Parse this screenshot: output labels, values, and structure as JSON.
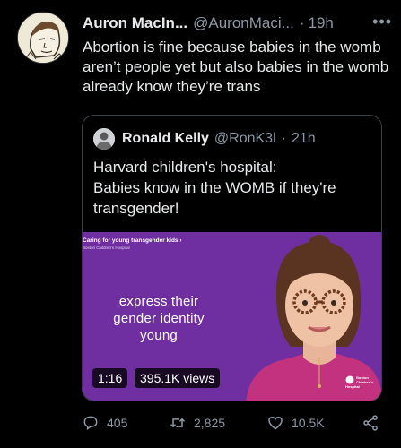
{
  "tweet": {
    "author_name": "Auron MacIn...",
    "author_handle": "@AuronMaci...",
    "separator": "·",
    "time": "19h",
    "more_label": "•••",
    "text": "Abortion is fine because babies in the womb aren’t people yet but also babies in the womb already know they’re trans"
  },
  "quote": {
    "author_name": "Ronald Kelly",
    "author_handle": "@RonK3l",
    "separator": "·",
    "time": "21h",
    "text_line1": "Harvard children's hospital:",
    "text_line2": "Babies know in the WOMB if they're transgender!",
    "media": {
      "heading": "Caring for young transgender kids  ›",
      "subheading": "Boston Children's Hospital",
      "caption": "express their gender identity young",
      "duration": "1:16",
      "views": "395.1K views",
      "logo_text": "Boston Children's Hospital",
      "bg_color": "#6f2fa1"
    }
  },
  "actions": {
    "reply_icon": "reply-icon",
    "reply_count": "405",
    "retweet_icon": "retweet-icon",
    "retweet_count": "2,825",
    "like_icon": "heart-icon",
    "like_count": "10.5K",
    "share_icon": "share-icon"
  }
}
